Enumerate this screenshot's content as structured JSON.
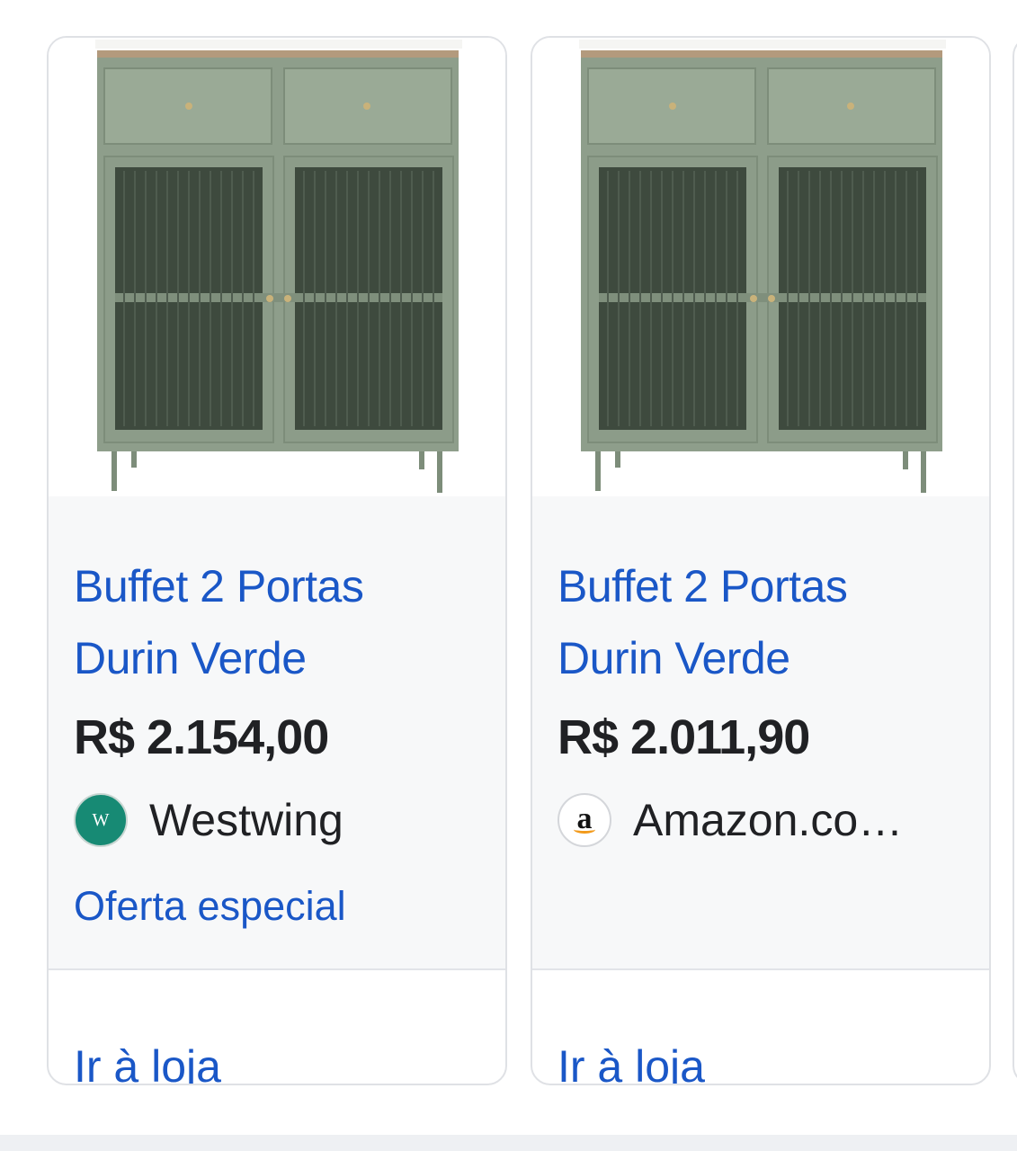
{
  "products": [
    {
      "title_line1": "Buffet 2 Portas",
      "title_line2": "Durin Verde",
      "price": "R$ 2.154,00",
      "store_logo_letter": "W",
      "store_name": "Westwing",
      "offer": "Oferta especial",
      "cta": "Ir à loja"
    },
    {
      "title_line1": "Buffet 2 Portas",
      "title_line2": "Durin Verde",
      "price": "R$ 2.011,90",
      "store_logo_letter": "a",
      "store_name": "Amazon.co…",
      "offer": "",
      "cta": "Ir à loja"
    }
  ],
  "colors": {
    "link": "#1a57c7",
    "cabinet_green": "#8d9d8a",
    "westwing_teal": "#178a74",
    "amazon_orange": "#f29a1b"
  },
  "icons": [
    "cabinet-image",
    "westwing-logo-icon",
    "amazon-logo-icon"
  ]
}
